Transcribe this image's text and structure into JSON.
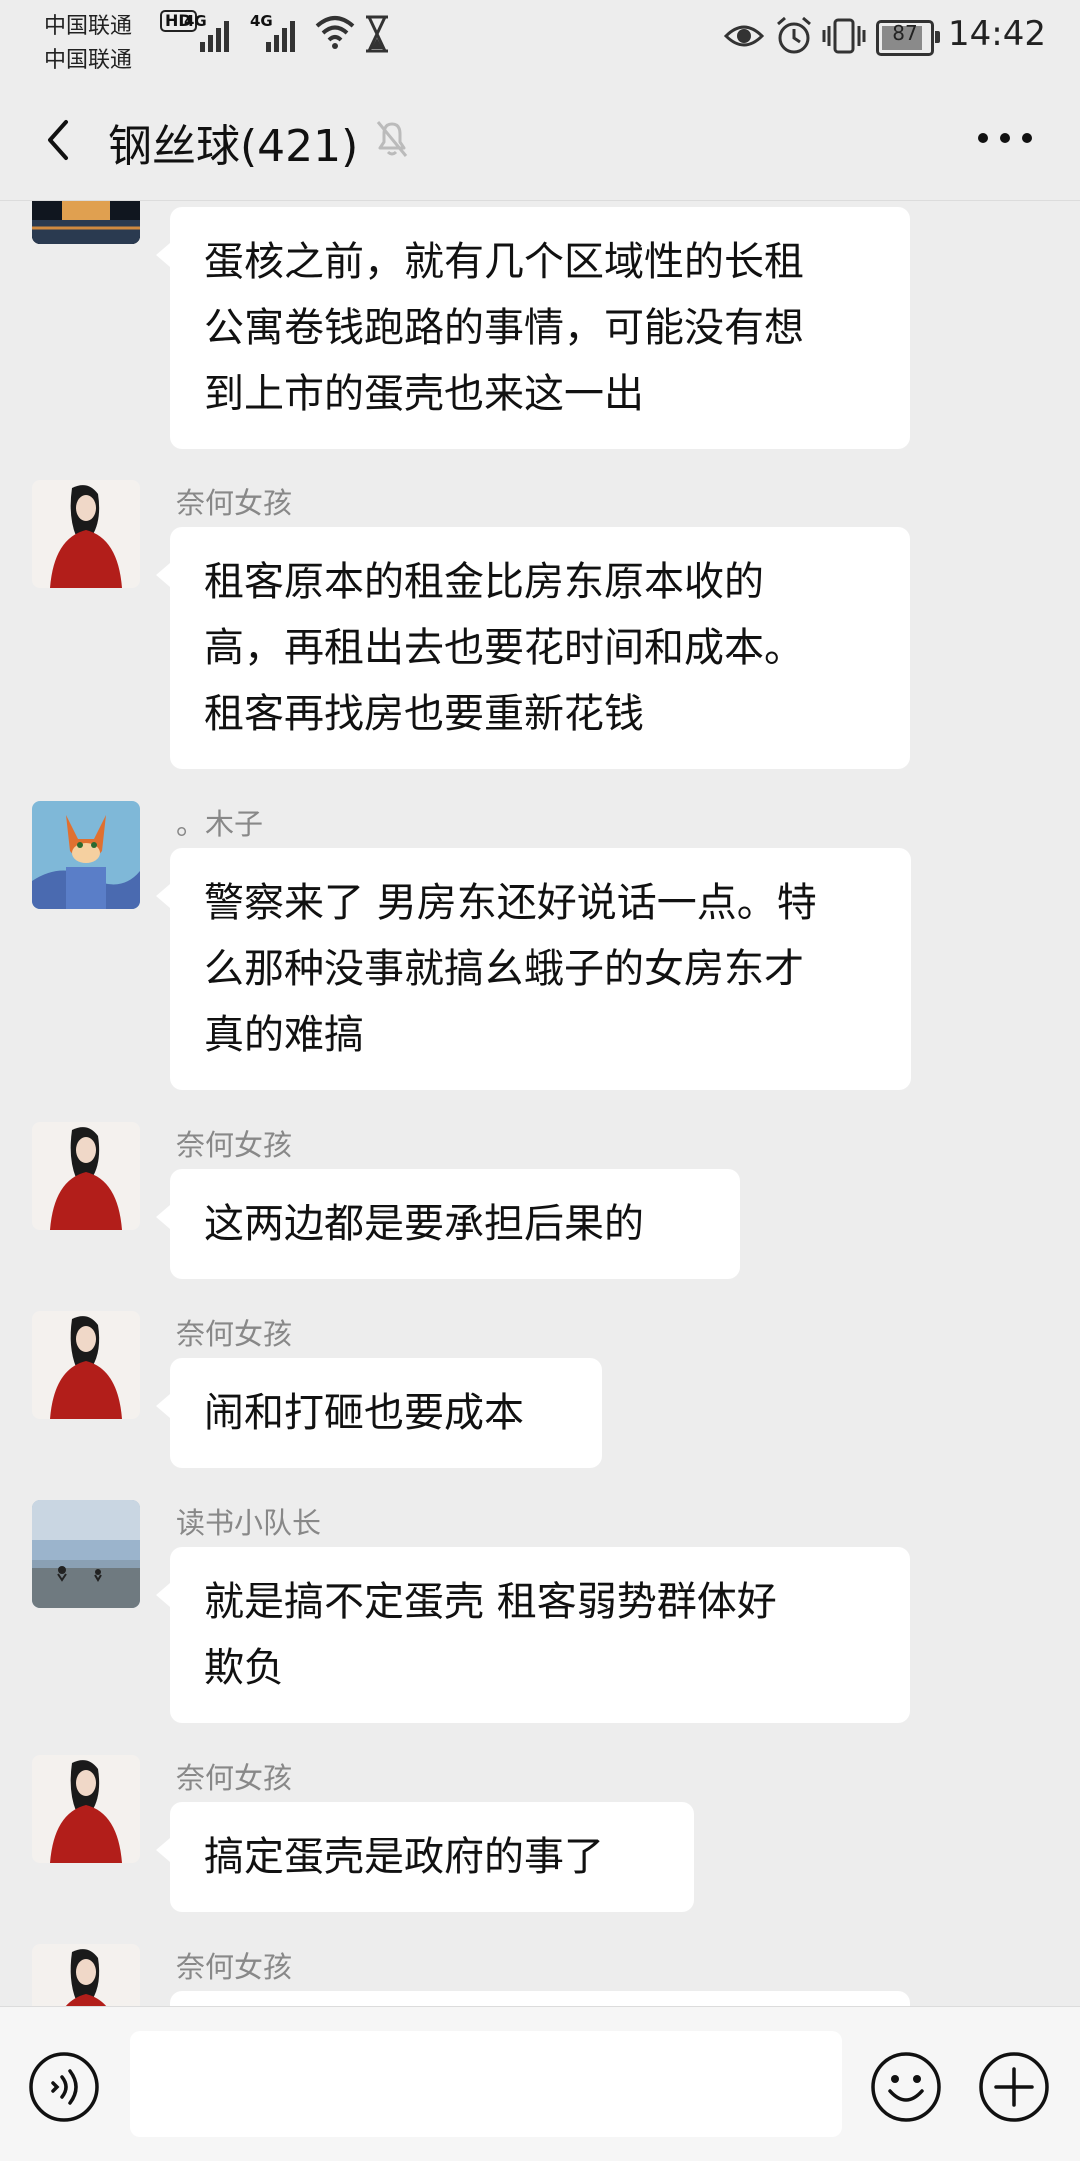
{
  "status_bar": {
    "carrier_1": "中国联通",
    "carrier_2": "中国联通",
    "hd_label": "HD",
    "signal_label": "4G",
    "battery": "87",
    "time": "14:42"
  },
  "header": {
    "title": "钢丝球(421)"
  },
  "messages": [
    {
      "sender": "",
      "avatar": "pavilion",
      "lines": [
        "蛋核之前，就有几个区域性的长租",
        "公寓卷钱跑路的事情，可能没有想",
        "到上市的蛋壳也来这一出"
      ]
    },
    {
      "sender": "奈何女孩",
      "avatar": "woman-red",
      "lines": [
        "租客原本的租金比房东原本收的",
        "高，再租出去也要花时间和成本。",
        "租客再找房也要重新花钱"
      ]
    },
    {
      "sender": "。木子",
      "avatar": "fox-cartoon",
      "lines": [
        "警察来了 男房东还好说话一点。特",
        "么那种没事就搞幺蛾子的女房东才",
        "真的难搞"
      ]
    },
    {
      "sender": "奈何女孩",
      "avatar": "woman-red",
      "lines": [
        "这两边都是要承担后果的"
      ]
    },
    {
      "sender": "奈何女孩",
      "avatar": "woman-red",
      "lines": [
        "闹和打砸也要成本"
      ]
    },
    {
      "sender": "读书小队长",
      "avatar": "beach-cyclists",
      "lines": [
        "就是搞不定蛋壳  租客弱势群体好",
        "欺负"
      ]
    },
    {
      "sender": "奈何女孩",
      "avatar": "woman-red",
      "lines": [
        "搞定蛋壳是政府的事了"
      ]
    },
    {
      "sender": "奈何女孩",
      "avatar": "woman-red",
      "lines": [
        ""
      ]
    }
  ],
  "input_bar": {
    "voice_icon": "voice-icon",
    "emoji_icon": "emoji-icon",
    "plus_icon": "plus-icon",
    "text_value": ""
  }
}
